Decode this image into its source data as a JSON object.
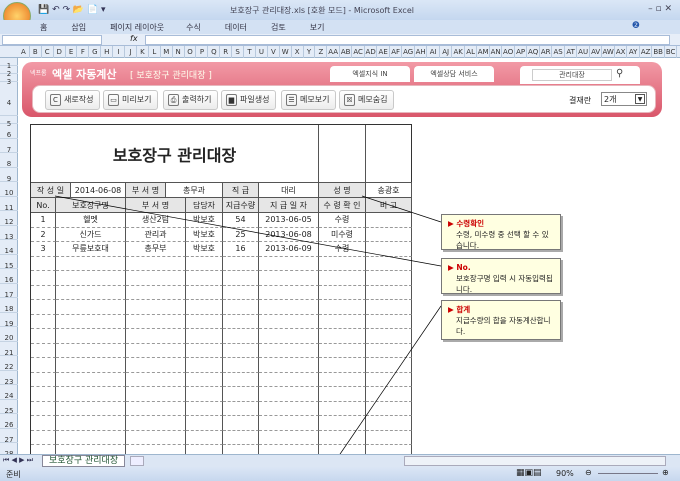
{
  "window": {
    "title": "보호장구 관리대장.xls  [호환 모드] - Microsoft Excel"
  },
  "ribbon": {
    "tabs": [
      "홈",
      "삽입",
      "페이지 레이아웃",
      "수식",
      "데이터",
      "검토",
      "보기"
    ]
  },
  "formula": {
    "fx": "fx",
    "value": ""
  },
  "columns": [
    "A",
    "B",
    "C",
    "D",
    "E",
    "F",
    "G",
    "H",
    "I",
    "J",
    "K",
    "L",
    "M",
    "N",
    "O",
    "P",
    "Q",
    "R",
    "S",
    "T",
    "U",
    "V",
    "W",
    "X",
    "Y",
    "Z",
    "AA",
    "AB",
    "AC",
    "AD",
    "AE",
    "AF",
    "AG",
    "AH",
    "AI",
    "AJ",
    "AK",
    "AL",
    "AM",
    "AN",
    "AO",
    "AP",
    "AQ",
    "AR",
    "AS",
    "AT",
    "AU",
    "AV",
    "AW",
    "AX",
    "AY",
    "AZ",
    "BB",
    "BC"
  ],
  "banner": {
    "brand": "넥프롬",
    "app": "엑셀 자동계산",
    "doc": "[ 보호장구 관리대장 ]",
    "tab1": "엑셀지식 IN",
    "tab2": "엑셀상담 서비스",
    "search_value": "관리대장"
  },
  "toolbar": {
    "buttons": [
      "새로작성",
      "미리보기",
      "출력하기",
      "파일생성",
      "메모보기",
      "메모숨김"
    ],
    "approval_label": "결재란",
    "approval_value": "2개"
  },
  "sheet": {
    "title": "보호장구 관리대장",
    "info": {
      "date_label": "작 성 일",
      "date": "2014-06-08",
      "dept_label": "부 서 명",
      "dept": "총무과",
      "rank_label": "직 급",
      "rank": "대리",
      "name_label": "성 명",
      "name": "송광호"
    },
    "headers": [
      "No.",
      "보호장구명",
      "부 서 명",
      "담당자",
      "지급수량",
      "지 급 일 자",
      "수 령 확 인",
      "비  고"
    ],
    "rows": [
      [
        "1",
        "헬멧",
        "생산2팀",
        "박보호",
        "54",
        "2013-06-05",
        "수령",
        ""
      ],
      [
        "2",
        "신가드",
        "관리과",
        "박보호",
        "25",
        "2013-06-08",
        "미수령",
        ""
      ],
      [
        "3",
        "무릎보호대",
        "총무부",
        "박보호",
        "16",
        "2013-06-09",
        "수령",
        ""
      ]
    ]
  },
  "comments": [
    {
      "title": "수령확인",
      "text": "수령, 미수령 중 선택 할 수 있습니다."
    },
    {
      "title": "No.",
      "text": "보호장구명 입력 시 자동입력됩니다."
    },
    {
      "title": "합계",
      "text": "지급수량의 합을 자동계산합니다."
    }
  ],
  "sheet_tab": "보호장구 관리대장",
  "status": {
    "ready": "준비",
    "zoom": "90%"
  }
}
